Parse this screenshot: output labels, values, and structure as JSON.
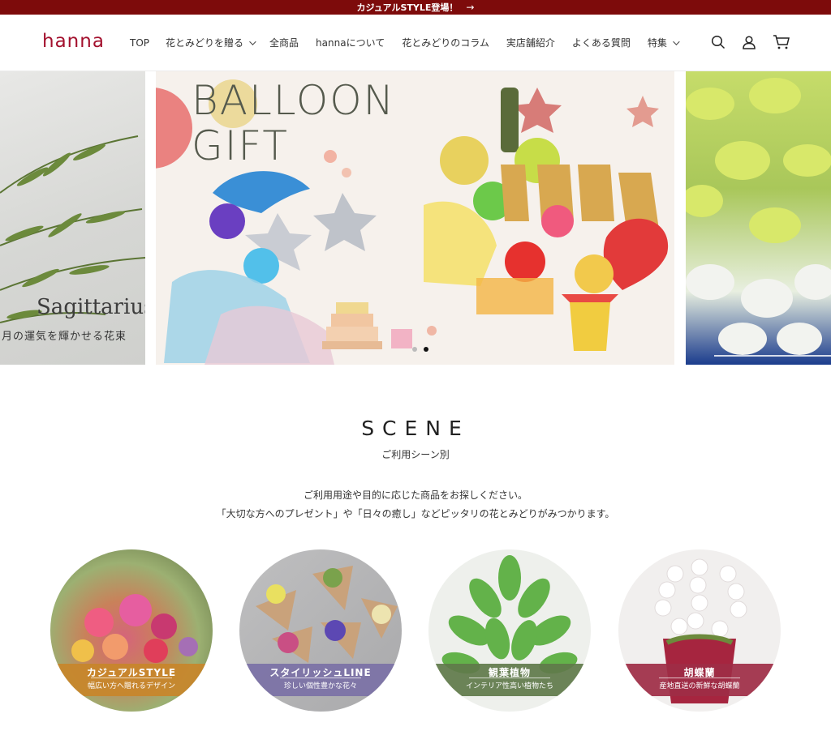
{
  "announcement": {
    "text": "カジュアルSTYLE登場！",
    "arrow": "→"
  },
  "header": {
    "logo": "hanna",
    "nav": [
      "TOP",
      "花とみどりを贈る",
      "全商品",
      "hannaについて",
      "花とみどりのコラム",
      "実店舗紹介",
      "よくある質問",
      "特集"
    ],
    "icons": [
      "search-icon",
      "account-icon",
      "cart-icon"
    ]
  },
  "carousel": {
    "left_slide": {
      "title": "Sagittarius",
      "subtitle": "月の運気を輝かせる花束"
    },
    "main_slide": {
      "title_line1": "BALLOON",
      "title_line2": "GIFT"
    },
    "dots": 2,
    "active_dot": 2
  },
  "scene": {
    "title": "SCENE",
    "subtitle": "ご利用シーン別",
    "desc_line1": "ご利用用途や目的に応じた商品をお探しください。",
    "desc_line2": "「大切な方へのプレゼント」や「日々の癒し」などピッタリの花とみどりがみつかります。",
    "items": [
      {
        "label": "カジュアルSTYLE",
        "sub": "幅広い方へ贈れるデザイン",
        "color": "#c8862a"
      },
      {
        "label": "スタイリッシュLINE",
        "sub": "珍しい個性豊かな花々",
        "color": "#7b71a6"
      },
      {
        "label": "観葉植物",
        "sub": "インテリア性高い植物たち",
        "color": "#5f7a4a"
      },
      {
        "label": "胡蝶蘭",
        "sub": "産地直送の新鮮な胡蝶蘭",
        "color": "#9e2d45"
      }
    ]
  }
}
